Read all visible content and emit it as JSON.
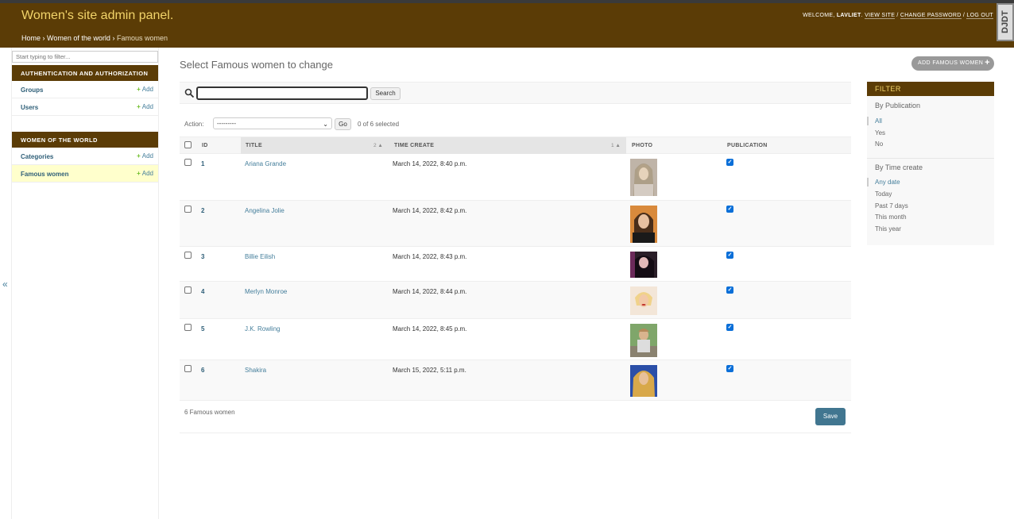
{
  "header": {
    "branding": "Women's site admin panel.",
    "welcome_prefix": "WELCOME,",
    "username": "LAVLIET",
    "view_site": "VIEW SITE",
    "change_password": "CHANGE PASSWORD",
    "log_out": "LOG OUT",
    "separator": "/",
    "djdt": "DJDT"
  },
  "breadcrumbs": {
    "home": "Home",
    "app": "Women of the world",
    "current": "Famous women",
    "sep": "›"
  },
  "nav": {
    "filter_placeholder": "Start typing to filter...",
    "collapse_icon": "«",
    "modules": [
      {
        "caption": "AUTHENTICATION AND AUTHORIZATION",
        "models": [
          {
            "name": "Groups",
            "add": "Add"
          },
          {
            "name": "Users",
            "add": "Add"
          }
        ]
      },
      {
        "caption": "WOMEN OF THE WORLD",
        "models": [
          {
            "name": "Categories",
            "add": "Add"
          },
          {
            "name": "Famous women",
            "add": "Add"
          }
        ]
      }
    ]
  },
  "content": {
    "title": "Select Famous women to change",
    "add_button": "ADD FAMOUS WOMEN",
    "search_button": "Search",
    "action_label": "Action:",
    "action_value": "---------",
    "go_button": "Go",
    "selected_counter": "0 of 6 selected",
    "columns": {
      "id": "ID",
      "title": "TITLE",
      "title_sort": "2",
      "time_create": "TIME CREATE",
      "time_sort": "1",
      "photo": "PHOTO",
      "publication": "PUBLICATION"
    },
    "rows": [
      {
        "id": "1",
        "title": "Ariana Grande",
        "time": "March 14, 2022, 8:40 p.m.",
        "published": true
      },
      {
        "id": "2",
        "title": "Angelina Jolie",
        "time": "March 14, 2022, 8:42 p.m.",
        "published": true
      },
      {
        "id": "3",
        "title": "Billie Eilish",
        "time": "March 14, 2022, 8:43 p.m.",
        "published": true
      },
      {
        "id": "4",
        "title": "Merlyn Monroe",
        "time": "March 14, 2022, 8:44 p.m.",
        "published": true
      },
      {
        "id": "5",
        "title": "J.K. Rowling",
        "time": "March 14, 2022, 8:45 p.m.",
        "published": true
      },
      {
        "id": "6",
        "title": "Shakira",
        "time": "March 15, 2022, 5:11 p.m.",
        "published": true
      }
    ],
    "paginator": "6 Famous women",
    "save_button": "Save"
  },
  "filter": {
    "heading": "FILTER",
    "groups": [
      {
        "title": "By Publication",
        "items": [
          "All",
          "Yes",
          "No"
        ],
        "selected": "All"
      },
      {
        "title": "By Time create",
        "items": [
          "Any date",
          "Today",
          "Past 7 days",
          "This month",
          "This year"
        ],
        "selected": "Any date"
      }
    ]
  },
  "colors": {
    "header_bg": "#5b3c06",
    "branding": "#f2d46a",
    "link": "#447e9b",
    "save_bg": "#417690"
  }
}
